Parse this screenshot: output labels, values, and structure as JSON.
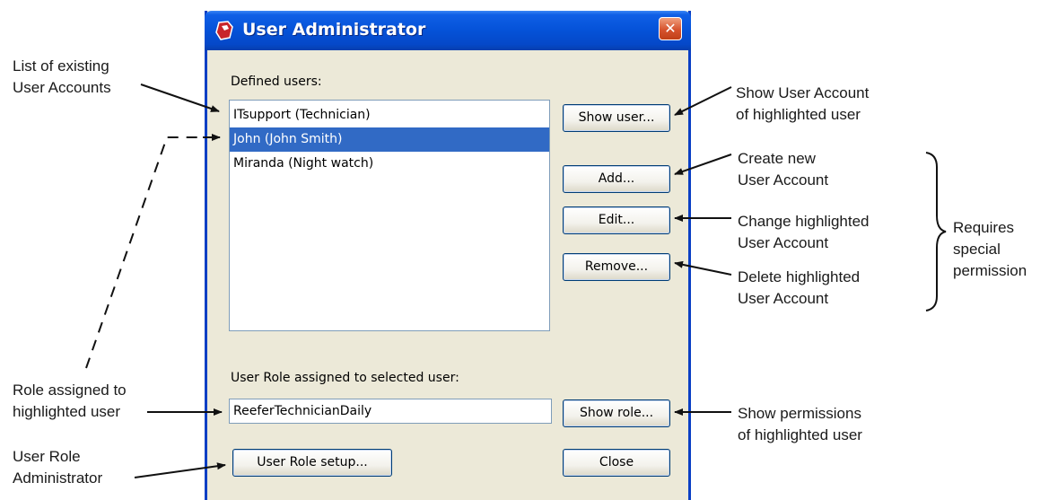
{
  "window": {
    "title": "User Administrator",
    "defined_users_label": "Defined users:",
    "users": [
      {
        "text": "ITsupport (Technician)",
        "selected": false
      },
      {
        "text": "John (John Smith)",
        "selected": true
      },
      {
        "text": "Miranda (Night watch)",
        "selected": false
      }
    ],
    "buttons": {
      "show_user": "Show user...",
      "add": "Add...",
      "edit": "Edit...",
      "remove": "Remove...",
      "show_role": "Show role...",
      "user_role_setup": "User Role setup...",
      "close": "Close",
      "close_icon": "✕"
    },
    "role_label": "User Role assigned to selected user:",
    "role_value": "ReeferTechnicianDaily"
  },
  "annotations": {
    "list_existing": [
      "List of existing",
      "User Accounts"
    ],
    "role_assigned": [
      "Role assigned to",
      "highlighted user"
    ],
    "user_role_admin": [
      "User Role",
      "Administrator"
    ],
    "show_user_account": [
      "Show User Account",
      "of highlighted user"
    ],
    "create_new": [
      "Create new",
      "User Account"
    ],
    "change_highlighted": [
      "Change highlighted",
      "User Account"
    ],
    "delete_highlighted": [
      "Delete highlighted",
      "User Account"
    ],
    "requires_special": [
      "Requires",
      "special",
      "permission"
    ],
    "show_permissions": [
      "Show permissions",
      "of highlighted user"
    ]
  },
  "colors": {
    "titlebar": "#0552d8",
    "selection": "#316ac5",
    "dialog_bg": "#ece9d8",
    "close_button": "#d6532e"
  }
}
